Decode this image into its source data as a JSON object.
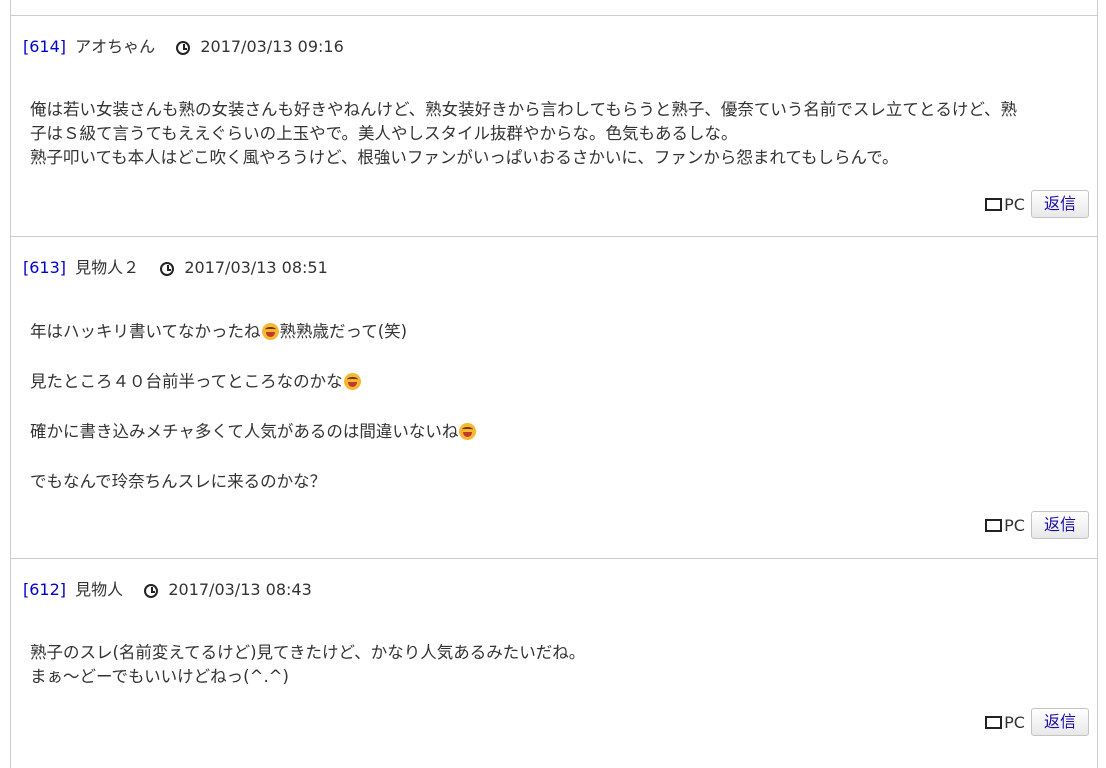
{
  "posts": [
    {
      "number": "[614]",
      "author": "アオちゃん",
      "timestamp": "2017/03/13 09:16",
      "lines": [
        "俺は若い女装さんも熟の女装さんも好きやねんけど、熟女装好きから言わしてもらうと熟子、優奈ていう名前でスレ立てとるけど、熟",
        "子はＳ級て言うてもええぐらいの上玉やで。美人やしスタイル抜群やからな。色気もあるしな。",
        "熟子叩いても本人はどこ吹く風やろうけど、根強いファンがいっぱいおるさかいに、ファンから怨まれてもしらんで。"
      ],
      "device": "PC",
      "reply_label": "返信"
    },
    {
      "number": "[613]",
      "author": "見物人２",
      "timestamp": "2017/03/13 08:51",
      "lines": [
        "年はハッキリ書いてなかったね",
        "熟熟歳だって(笑)",
        "見たところ４０台前半ってところなのかな",
        "確かに書き込みメチャ多くて人気があるのは間違いないね",
        "でもなんで玲奈ちんスレに来るのかな？"
      ],
      "device": "PC",
      "reply_label": "返信"
    },
    {
      "number": "[612]",
      "author": "見物人",
      "timestamp": "2017/03/13 08:43",
      "lines": [
        "熟子のスレ(名前変えてるけど)見てきたけど、かなり人気あるみたいだね。",
        "まぁ〜どーでもいいけどねっ(^.^)"
      ],
      "device": "PC",
      "reply_label": "返信"
    }
  ],
  "icons": {
    "clock": "clock-icon",
    "device": "monitor-icon",
    "emoji": "grinning-face-icon"
  },
  "colors": {
    "post_number": "#0000cc",
    "text": "#333333",
    "border": "#cccccc",
    "reply_text": "#1a0dab"
  }
}
